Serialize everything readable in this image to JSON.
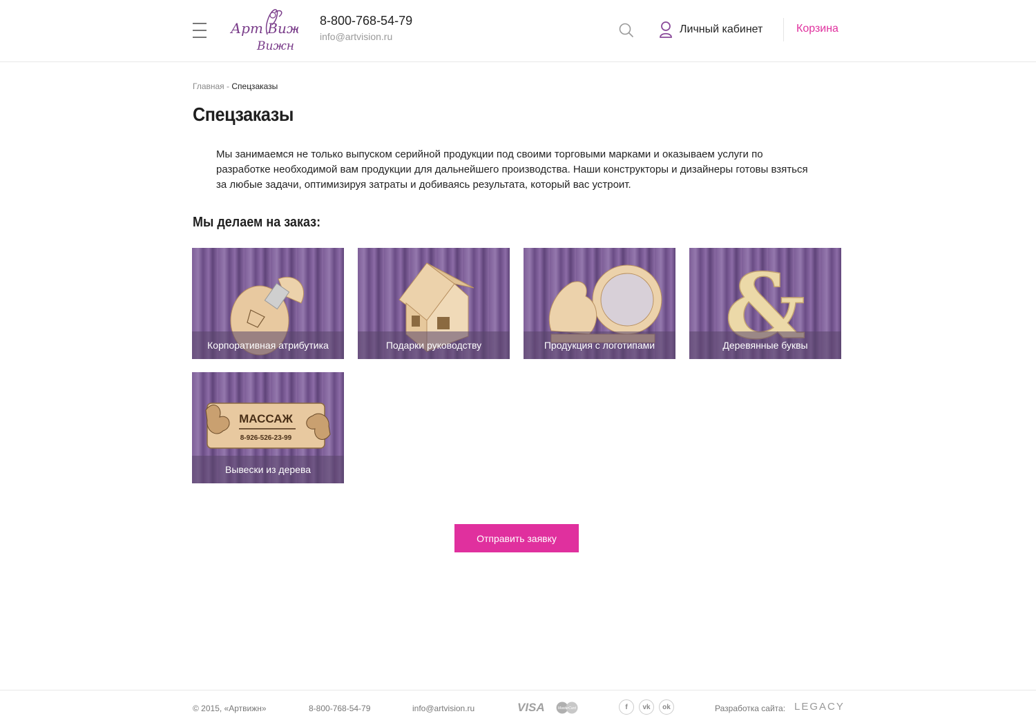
{
  "header": {
    "logo_text": "Арт Вижн",
    "phone": "8-800-768-54-79",
    "email": "info@artvision.ru",
    "account_label": "Личный кабинет",
    "cart_label": "Корзина"
  },
  "breadcrumb": {
    "home": "Главная",
    "separator": " - ",
    "current": "Спецзаказы"
  },
  "page_title": "Спецзаказы",
  "intro": "Мы занимаемся не только выпуском серийной продукции под своими торговыми марками и оказываем услуги по разработке необходимой вам продукции для дальнейшего производства. Наши конструкторы и дизайнеры готовы взяться за любые задачи, оптимизируя затраты и добиваясь результата, который вас устроит.",
  "section_title": "Мы делаем на заказ:",
  "tiles": [
    {
      "caption": "Корпоративная атрибутика",
      "image": "wooden-usb-flash-drive"
    },
    {
      "caption": "Подарки руководству",
      "image": "wooden-house"
    },
    {
      "caption": "Продукция с логотипами",
      "image": "wooden-dragon-calendar"
    },
    {
      "caption": "Деревянные буквы",
      "image": "wooden-ampersand"
    },
    {
      "caption": "Вывески из дерева",
      "image": "wooden-sign",
      "sign_title": "МАССАЖ",
      "sign_phone": "8-926-526-23-99"
    }
  ],
  "submit_label": "Отправить заявку",
  "footer": {
    "copyright": "© 2015, «Артвижн»",
    "phone": "8-800-768-54-79",
    "email": "info@artvision.ru",
    "payment_visa": "VISA",
    "payment_mastercard": "MasterCard",
    "social": [
      "f",
      "vk",
      "ok"
    ],
    "developer_label": "Разработка сайта:",
    "developer_name": "LEGACY"
  },
  "colors": {
    "accent": "#e0309e",
    "logo": "#7a3d8a",
    "tile_background": "#7e5f98"
  }
}
